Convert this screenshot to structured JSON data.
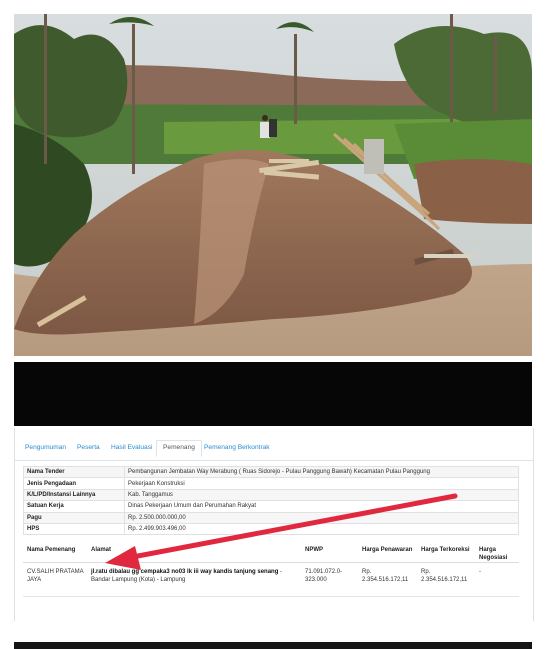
{
  "photo": {
    "description_icon": "construction-site-photo"
  },
  "tabs": [
    {
      "label": "Pengumuman"
    },
    {
      "label": "Peserta"
    },
    {
      "label": "Hasil Evaluasi"
    },
    {
      "label": "Pemenang"
    },
    {
      "label": "Pemenang Berkontrak"
    }
  ],
  "info": {
    "rows": [
      {
        "key": "Nama Tender",
        "value": "Pembangunan Jembatan Way Merabung ( Ruas Sidorejo - Pulau Panggung Bawah) Kecamatan Pulau Panggung"
      },
      {
        "key": "Jenis Pengadaan",
        "value": "Pekerjaan Konstruksi"
      },
      {
        "key": "K/L/PD/Instansi Lainnya",
        "value": "Kab. Tanggamus"
      },
      {
        "key": "Satuan Kerja",
        "value": "Dinas Pekerjaan Umum dan Perumahan Rakyat"
      },
      {
        "key": "Pagu",
        "value": "Rp. 2.500.000.000,00"
      },
      {
        "key": "HPS",
        "value": "Rp. 2.499.903.496,00"
      }
    ]
  },
  "winner": {
    "headers": {
      "nama": "Nama Pemenang",
      "alamat": "Alamat",
      "npwp": "NPWP",
      "penawaran": "Harga Penawaran",
      "terkoreksi": "Harga Terkoreksi",
      "negosiasi": "Harga Negosiasi"
    },
    "row": {
      "nama": "CV.SALIH PRATAMA JAYA",
      "alamat_bold": "jl.ratu dibalau gg cempaka3 no03 lk iii way kandis tanjung senang",
      "alamat_rest": " - Bandar Lampung (Kota) - Lampung",
      "npwp": "71.091.072.0-323.000",
      "penawaran": "Rp. 2.354.516.172,11",
      "terkoreksi": "Rp. 2.354.516.172,11",
      "negosiasi": "-"
    }
  },
  "annotation": {
    "arrow_color": "#e0283f",
    "arrow_icon": "red-arrow-icon"
  }
}
